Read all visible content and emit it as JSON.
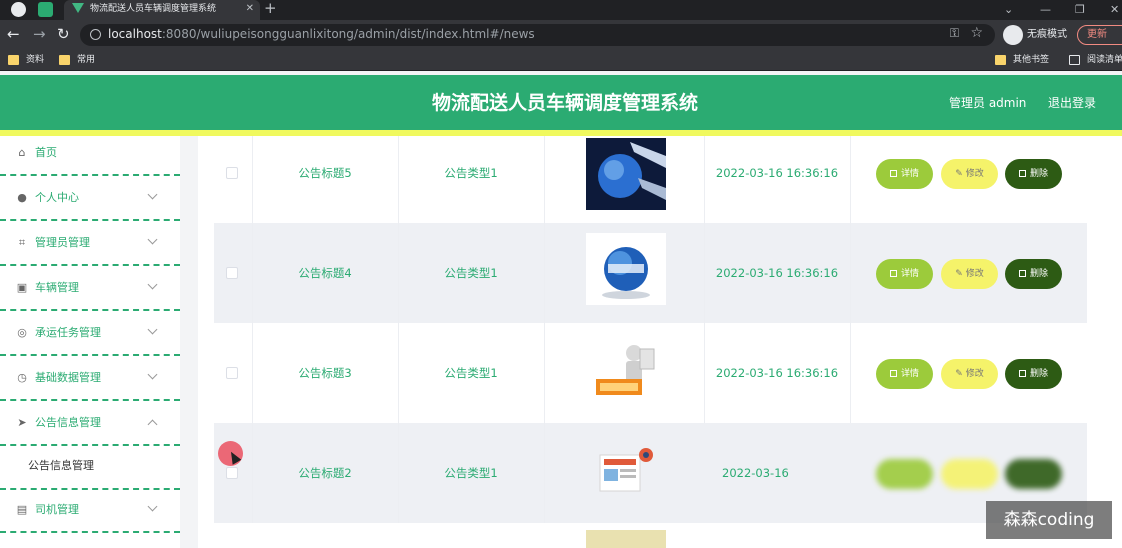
{
  "browser": {
    "tab_title": "物流配送人员车辆调度管理系统",
    "url_host": "localhost",
    "url_rest": ":8080/wuliupeisongguanlixitong/admin/dist/index.html#/news",
    "profile_label": "无痕模式",
    "update_label": "更新",
    "bookmarks": [
      "资料",
      "常用",
      "其他书签",
      "阅读清单"
    ]
  },
  "header": {
    "title": "物流配送人员车辆调度管理系统",
    "admin_label": "管理员 admin",
    "logout_label": "退出登录"
  },
  "sidebar": {
    "items": [
      {
        "label": "首页",
        "icon": "home-icon"
      },
      {
        "label": "个人中心",
        "icon": "user-icon"
      },
      {
        "label": "管理员管理",
        "icon": "crop-icon"
      },
      {
        "label": "车辆管理",
        "icon": "clipboard-icon"
      },
      {
        "label": "承运任务管理",
        "icon": "target-icon"
      },
      {
        "label": "基础数据管理",
        "icon": "compass-icon"
      },
      {
        "label": "公告信息管理",
        "icon": "send-icon"
      },
      {
        "label": "司机管理",
        "icon": "document-icon"
      }
    ],
    "sub_item": "公告信息管理"
  },
  "table": {
    "rows": [
      {
        "title": "公告标题5",
        "type": "公告类型1",
        "time": "2022-03-16 16:36:16",
        "image": "globe-ribbon-image"
      },
      {
        "title": "公告标题4",
        "type": "公告类型1",
        "time": "2022-03-16 16:36:16",
        "image": "news-globe-image"
      },
      {
        "title": "公告标题3",
        "type": "公告类型1",
        "time": "2022-03-16 16:36:16",
        "image": "news-figure-image"
      },
      {
        "title": "公告标题2",
        "type": "公告类型1",
        "time": "2022-03-16",
        "image": "newspaper-image"
      }
    ],
    "actions": {
      "detail": "详情",
      "edit": "修改",
      "delete": "删除"
    }
  },
  "watermark": "森森coding",
  "colors": {
    "primary": "#2bab72",
    "accent_yellow": "#f0f95e",
    "detail_btn": "#9ccb3b",
    "edit_btn": "#f5f36a",
    "delete_btn": "#2d5b14"
  }
}
